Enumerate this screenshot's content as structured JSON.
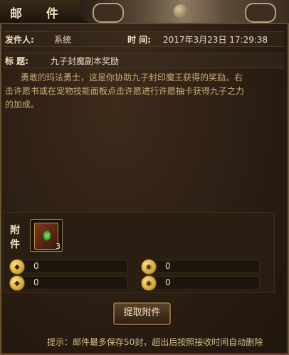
{
  "window": {
    "title": "邮  件"
  },
  "header": {
    "sender_label": "发件人:",
    "sender_value": "系统",
    "time_label": "时  间:",
    "time_value": "2017年3月23日  17:29:38",
    "subject_label": "标  题:",
    "subject_value": "九子封魔副本奖励"
  },
  "message": {
    "line1": "勇敢的玛法勇士，这是你协助九子封印魔王获得的奖励。右",
    "line2": "击许愿书或在宠物技能面板点击许愿进行许愿抽卡获得九子之力",
    "line3": "的加成。"
  },
  "attachment": {
    "label": "附件",
    "item": {
      "icon": "wish-book-icon",
      "count": "3"
    },
    "currencies": [
      {
        "icon": "gold-ingot-icon",
        "value": "0"
      },
      {
        "icon": "coin-icon",
        "value": "0"
      },
      {
        "icon": "bound-gold-ingot-icon",
        "value": "0"
      },
      {
        "icon": "bound-coin-icon",
        "value": "0"
      }
    ]
  },
  "actions": {
    "take_attachment": "提取附件"
  },
  "footer": {
    "hint": "提示：邮件最多保存50封，超出后按照接收时间自动删除"
  }
}
